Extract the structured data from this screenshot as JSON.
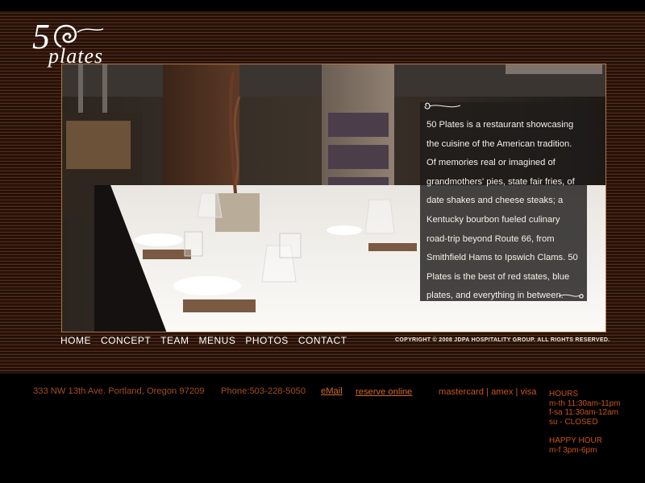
{
  "brand": {
    "logo_text": "50plates"
  },
  "description": {
    "text": "50 Plates is a restaurant showcasing the cuisine of the American tradition. Of memories real or imagined of grandmothers' pies, state fair fries, of date shakes and cheese steaks; a Kentucky bourbon fueled culinary road-trip beyond Route 66, from Smithfield Hams to Ipswich Clams. 50 Plates is the best of red states, blue plates, and everything in between."
  },
  "nav": {
    "items": [
      {
        "label": "HOME"
      },
      {
        "label": "CONCEPT"
      },
      {
        "label": "TEAM"
      },
      {
        "label": "MENUS"
      },
      {
        "label": "PHOTOS"
      },
      {
        "label": "CONTACT"
      }
    ]
  },
  "copyright": "COPYRIGHT © 2008 JDPA HOSPITALITY GROUP. ALL RIGHTS RESERVED.",
  "footer": {
    "address": "333 NW 13th Ave. Portland, Oregon 97209",
    "phone": "Phone:503-228-5050",
    "email_link": "eMail",
    "reserve_link": "reserve online",
    "payment": "mastercard | amex | visa",
    "hours": {
      "title": "HOURS",
      "weekdays": "m-th 11:30am-11pm",
      "weekend": "f-sa 11:30am-12am",
      "sunday": "su - CLOSED",
      "happy_hour_title": "HAPPY HOUR",
      "happy_hour": "m-f 3pm-6pm"
    }
  },
  "colors": {
    "accent": "#c9541a",
    "frame_border": "#b5763f",
    "panel_bg": "#1e1c1b"
  }
}
